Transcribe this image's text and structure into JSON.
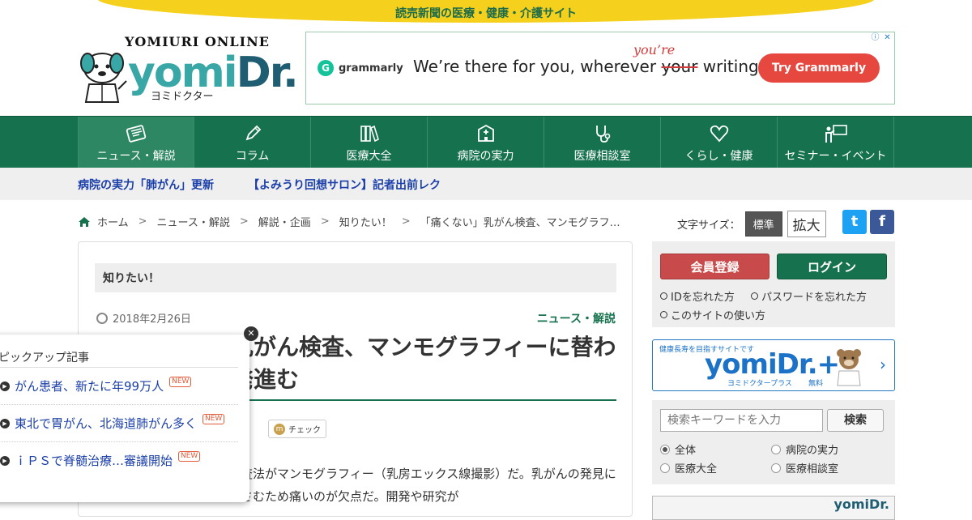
{
  "topbar": {
    "text": "読売新聞の医療・健康・介護サイト"
  },
  "logo": {
    "top": "YOMIURI ONLINE",
    "main_a": "yomi",
    "main_b": "Dr.",
    "kana": "ヨミドクター"
  },
  "ad": {
    "brand": "grammarly",
    "text_before": "We’re there for you, wherever ",
    "text_strike": "your",
    "text_after": " writing.",
    "correction": "you’re",
    "cta": "Try Grammarly"
  },
  "nav": {
    "items": [
      {
        "label": "ニュース・解説",
        "icon": "newspaper-icon"
      },
      {
        "label": "コラム",
        "icon": "pencil-icon"
      },
      {
        "label": "医療大全",
        "icon": "books-icon"
      },
      {
        "label": "病院の実力",
        "icon": "hospital-icon"
      },
      {
        "label": "医療相談室",
        "icon": "stethoscope-icon"
      },
      {
        "label": "くらし・健康",
        "icon": "heart-icon"
      },
      {
        "label": "セミナー・イベント",
        "icon": "presenter-icon"
      }
    ]
  },
  "subnav": {
    "link1": "病院の実力「肺がん」更新",
    "link2": "【よみうり回想サロン】記者出前レク"
  },
  "breadcrumb": {
    "home": "ホーム",
    "items": [
      "ニュース・解説",
      "解説・企画",
      "知りたい！",
      "「痛くない」乳がん検査、マンモグラフ…"
    ]
  },
  "fontsize": {
    "label": "文字サイズ：",
    "standard": "標準",
    "large": "拡大"
  },
  "social": {
    "twitter": "t",
    "facebook": "f"
  },
  "article": {
    "category": "知りたい！",
    "date": "2018年2月26日",
    "section": "ニュース・解説",
    "title": "「痛くない」乳がん検査、マンモグラフィーに替わる新技術の開発進む",
    "check": "チェック",
    "body": "乳がん検診で用いられる検査法がマンモグラフィー（乳房エックス線撮影）だ。乳がんの発見に効果がある反面、乳房をはさむため痛いのが欠点だ。開発や研究が"
  },
  "member": {
    "register": "会員登録",
    "login": "ログイン",
    "forgot_id": "IDを忘れた方",
    "forgot_pw": "パスワードを忘れた方",
    "howto": "このサイトの使い方"
  },
  "plus_banner": {
    "small": "健康長寿を目指すサイトです",
    "logo": "yomiDr.+",
    "kana": "ヨミドクタープラス",
    "free": "無料"
  },
  "search": {
    "placeholder": "検索キーワードを入力",
    "button": "検索",
    "options": [
      "全体",
      "病院の実力",
      "医療大全",
      "医療相談室"
    ],
    "selected": "全体"
  },
  "side_ad": {
    "logo": "yomiDr."
  },
  "pickup": {
    "heading": "ピックアップ記事",
    "items": [
      {
        "text": "がん患者、新たに年99万人",
        "badge": "NEW"
      },
      {
        "text": "東北で胃がん、北海道肺がん多く",
        "badge": "NEW"
      },
      {
        "text": "ｉＰＳで脊髄治療…審議開始",
        "badge": "NEW"
      }
    ]
  },
  "colors": {
    "nav_green": "#16724e",
    "topbar_yellow": "#f5d01c",
    "link_blue": "#1b3fa8",
    "register_red": "#c84a4a"
  }
}
